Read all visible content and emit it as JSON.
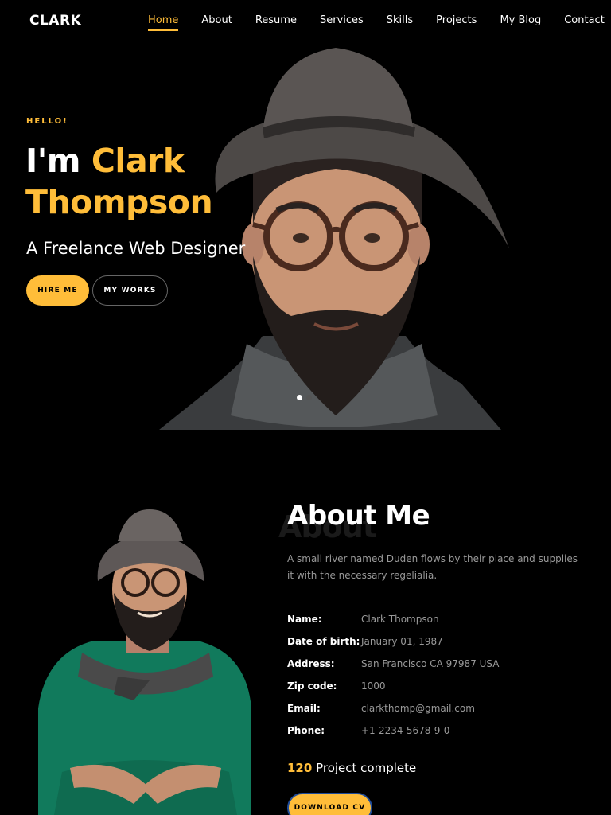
{
  "nav": {
    "brand": "CLARK",
    "items": [
      {
        "label": "Home",
        "active": true
      },
      {
        "label": "About",
        "active": false
      },
      {
        "label": "Resume",
        "active": false
      },
      {
        "label": "Services",
        "active": false
      },
      {
        "label": "Skills",
        "active": false
      },
      {
        "label": "Projects",
        "active": false
      },
      {
        "label": "My Blog",
        "active": false
      },
      {
        "label": "Contact",
        "active": false
      }
    ]
  },
  "hero": {
    "greeting": "HELLO!",
    "title_prefix": "I'm",
    "first_name": "Clark",
    "last_name": "Thompson",
    "subtitle": "A Freelance Web Designer",
    "hire_button": "HIRE ME",
    "works_button": "MY WORKS",
    "slides": {
      "count": 2,
      "active_index": 0
    }
  },
  "about": {
    "ghost_title": "About",
    "title": "About Me",
    "description": "A small river named Duden flows by their place and supplies it with the necessary regelialia.",
    "details": [
      {
        "label": "Name:",
        "value": "Clark Thompson"
      },
      {
        "label": "Date of birth:",
        "value": "January 01, 1987"
      },
      {
        "label": "Address:",
        "value": "San Francisco CA 97987 USA"
      },
      {
        "label": "Zip code:",
        "value": "1000"
      },
      {
        "label": "Email:",
        "value": "clarkthomp@gmail.com"
      },
      {
        "label": "Phone:",
        "value": "+1-2234-5678-9-0"
      }
    ],
    "projects_count": "120",
    "projects_label": "Project complete",
    "download_button": "DOWNLOAD CV"
  },
  "colors": {
    "accent": "#ffbd39",
    "background": "#000000",
    "muted_text": "#999999"
  }
}
